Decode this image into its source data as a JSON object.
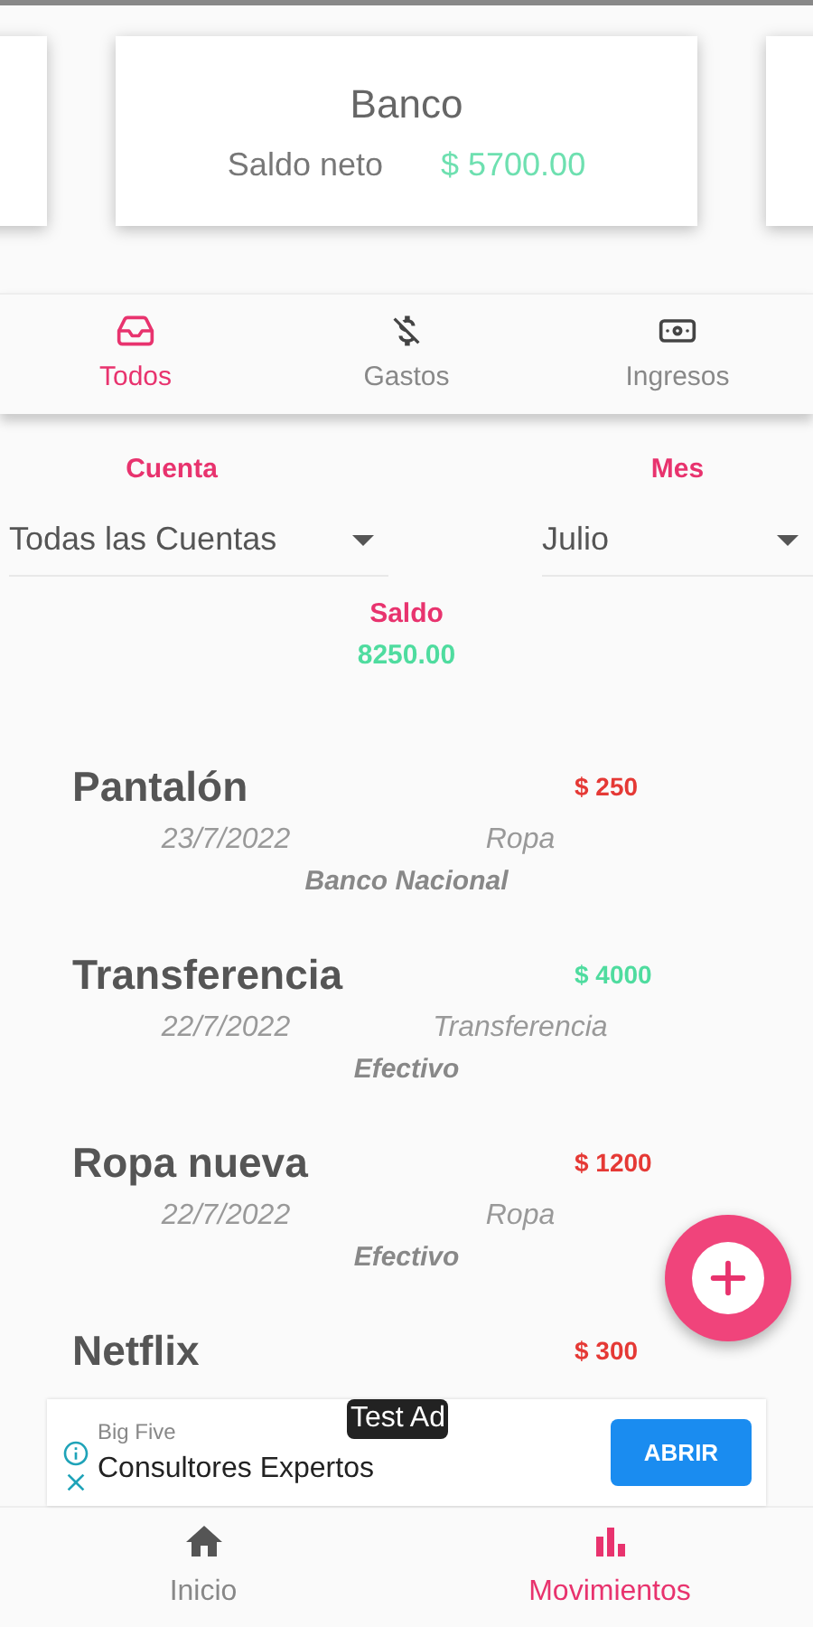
{
  "accounts": [
    {
      "kind": "hidden"
    },
    {
      "kind": "shown",
      "name": "Banco",
      "balance_label": "Saldo neto",
      "balance": "$ 5700.00"
    },
    {
      "kind": "hidden"
    }
  ],
  "tabs": [
    {
      "kind": "all",
      "label": "Todos",
      "selected": true
    },
    {
      "kind": "expense",
      "label": "Gastos",
      "selected": false
    },
    {
      "kind": "income",
      "label": "Ingresos",
      "selected": false
    }
  ],
  "filters": {
    "account": {
      "label": "Cuenta",
      "value": "Todas las Cuentas"
    },
    "month": {
      "label": "Mes",
      "value": "Julio"
    }
  },
  "saldo": {
    "label": "Saldo",
    "value": "8250.00"
  },
  "transactions": [
    {
      "title": "Pantalón",
      "amount": "$ 250",
      "kind": "expense",
      "date": "23/7/2022",
      "category": "Ropa",
      "account": "Banco Nacional"
    },
    {
      "title": "Transferencia",
      "amount": "$ 4000",
      "kind": "income",
      "date": "22/7/2022",
      "category": "Transferencia",
      "account": "Efectivo"
    },
    {
      "title": "Ropa nueva",
      "amount": "$ 1200",
      "kind": "expense",
      "date": "22/7/2022",
      "category": "Ropa",
      "account": "Efectivo"
    },
    {
      "title": "Netflix",
      "amount": "$ 300",
      "kind": "expense"
    }
  ],
  "ad": {
    "badge": "Test Ad",
    "sponsor": "Big Five",
    "headline": "Consultores Expertos",
    "button": "ABRIR"
  },
  "bottom_nav": [
    {
      "kind": "home",
      "label": "Inicio",
      "selected": false
    },
    {
      "kind": "chart",
      "label": "Movimientos",
      "selected": true
    }
  ]
}
